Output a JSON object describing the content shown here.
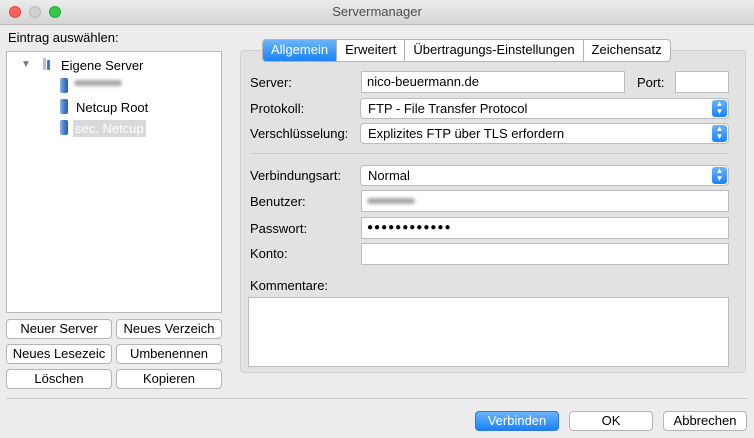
{
  "window": {
    "title": "Servermanager"
  },
  "left": {
    "heading": "Eintrag auswählen:",
    "tree": {
      "root": "Eigene Server",
      "items": [
        {
          "label": "",
          "redacted": true
        },
        {
          "label": "Netcup Root"
        },
        {
          "label": "sec. Netcup",
          "selected": true
        }
      ]
    },
    "buttons": {
      "new_server": "Neuer Server",
      "new_folder": "Neues Verzeich",
      "new_bookmark": "Neues Lesezeic",
      "rename": "Umbenennen",
      "delete": "Löschen",
      "copy": "Kopieren"
    }
  },
  "tabs": [
    "Allgemein",
    "Erweitert",
    "Übertragungs-Einstellungen",
    "Zeichensatz"
  ],
  "active_tab": "Allgemein",
  "form": {
    "server_label": "Server:",
    "server_value": "nico-beuermann.de",
    "port_label": "Port:",
    "port_value": "",
    "protocol_label": "Protokoll:",
    "protocol_value": "FTP - File Transfer Protocol",
    "encryption_label": "Verschlüsselung:",
    "encryption_value": "Explizites FTP über TLS erfordern",
    "logontype_label": "Verbindungsart:",
    "logontype_value": "Normal",
    "user_label": "Benutzer:",
    "user_value": "",
    "password_label": "Passwort:",
    "password_value": "●●●●●●●●●●●●",
    "account_label": "Konto:",
    "account_value": "",
    "comments_label": "Kommentare:",
    "comments_value": ""
  },
  "footer": {
    "connect": "Verbinden",
    "ok": "OK",
    "cancel": "Abbrechen"
  },
  "colors": {
    "accent": "#1a82fb",
    "close": "#fc605c",
    "maximize": "#34c84a"
  }
}
